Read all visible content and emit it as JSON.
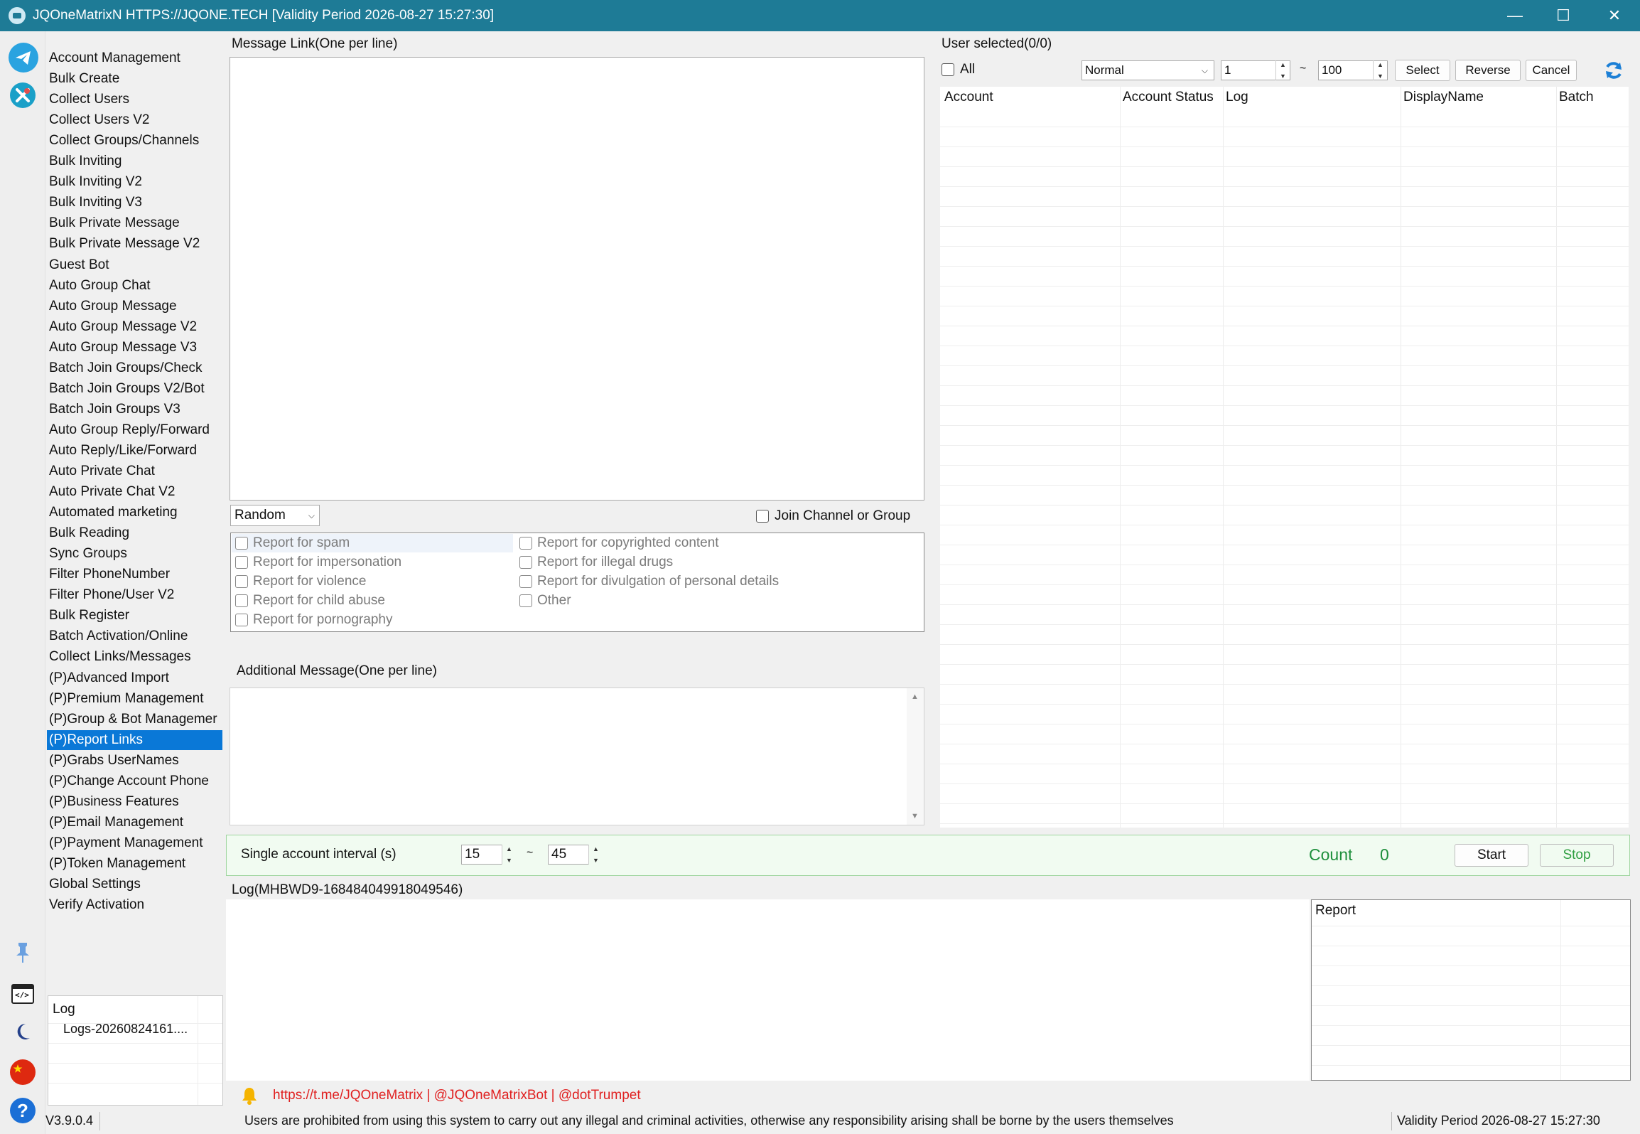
{
  "window": {
    "title": "JQOneMatrixN HTTPS://JQONE.TECH  [Validity Period 2026-08-27 15:27:30]",
    "minimize": "—",
    "maximize": "☐",
    "close": "✕"
  },
  "menu": {
    "items": [
      "Account Management",
      "Bulk Create",
      "Collect Users",
      "Collect Users V2",
      "Collect Groups/Channels",
      "Bulk Inviting",
      "Bulk Inviting V2",
      "Bulk Inviting V3",
      "Bulk Private Message",
      "Bulk Private Message V2",
      "Guest Bot",
      "Auto Group Chat",
      "Auto Group Message",
      "Auto Group Message V2",
      "Auto Group Message V3",
      "Batch Join Groups/Check",
      "Batch Join Groups V2/Bot",
      "Batch Join Groups V3",
      "Auto Group Reply/Forward",
      "Auto Reply/Like/Forward",
      "Auto Private Chat",
      "Auto Private Chat V2",
      "Automated marketing",
      "Bulk Reading",
      "Sync Groups",
      "Filter PhoneNumber",
      "Filter Phone/User V2",
      "Bulk Register",
      "Batch Activation/Online",
      "Collect Links/Messages",
      "(P)Advanced Import",
      "(P)Premium Management",
      "(P)Group & Bot Managemer",
      "(P)Report Links",
      "(P)Grabs UserNames",
      "(P)Change Account Phone",
      "(P)Business Features",
      "(P)Email Management",
      "(P)Payment Management",
      "(P)Token Management",
      "Global Settings",
      "Verify Activation"
    ],
    "active_index": 33
  },
  "side_log": {
    "header": "Log",
    "entry": "Logs-20260824161...."
  },
  "message_link": {
    "label": "Message Link(One per line)",
    "value": ""
  },
  "mode_select": {
    "value": "Random"
  },
  "join_channel": {
    "label": "Join Channel or Group",
    "checked": false
  },
  "report_options": [
    "Report for spam",
    "Report for impersonation",
    "Report for violence",
    "Report for child abuse",
    "Report for pornography",
    "Report for copyrighted content",
    "Report for illegal drugs",
    "Report for divulgation of personal details",
    "Other"
  ],
  "additional_message": {
    "label": "Additional Message(One per line)",
    "value": ""
  },
  "users": {
    "title": "User selected(0/0)",
    "all_label": "All",
    "type_select": "Normal",
    "range_from": "1",
    "range_sep": "~",
    "range_to": "100",
    "select_btn": "Select",
    "reverse_btn": "Reverse",
    "cancel_btn": "Cancel",
    "columns": [
      "Account",
      "Account Status",
      "Log",
      "DisplayName",
      "Batch"
    ]
  },
  "interval": {
    "label": "Single account interval (s)",
    "min": "15",
    "sep": "~",
    "max": "45",
    "count_label": "Count",
    "count_value": "0",
    "start_btn": "Start",
    "stop_btn": "Stop"
  },
  "log_panel": {
    "title": "Log(MHBWD9-168484049918049546)",
    "report_header": "Report"
  },
  "links_line": "https://t.me/JQOneMatrix | @JQOneMatrixBot | @dotTrumpet",
  "status": {
    "version": "V3.9.0.4",
    "notice": "Users are prohibited from using this system to carry out any illegal and criminal activities, otherwise any responsibility arising shall be borne by the users themselves",
    "validity": "Validity Period 2026-08-27 15:27:30"
  },
  "icons": {
    "sidebar": [
      "telegram-icon",
      "tools-icon",
      "pin-icon",
      "code-window-icon",
      "moon-icon",
      "china-flag-icon",
      "help-icon"
    ],
    "bell": "bell-icon",
    "refresh": "refresh-icon"
  },
  "colors": {
    "titlebar": "#1e7b96",
    "active_menu": "#0a78d7",
    "count_green": "#1e8f3c",
    "stop_green": "#2e9e40",
    "links_red": "#e02020",
    "bottom_panel": "#f1fbf1"
  }
}
